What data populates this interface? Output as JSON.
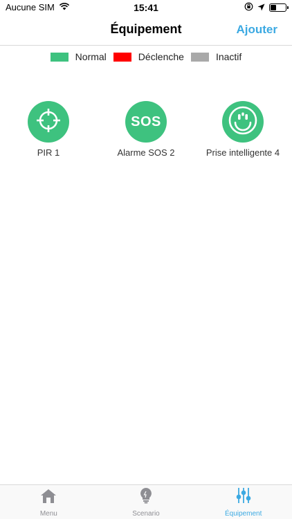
{
  "status_bar": {
    "carrier": "Aucune SIM",
    "time": "15:41",
    "battery_level": 0.4
  },
  "nav": {
    "title": "Équipement",
    "add_label": "Ajouter"
  },
  "legend": [
    {
      "label": "Normal",
      "color": "#3ec27f"
    },
    {
      "label": "Déclenche",
      "color": "#ff0000"
    },
    {
      "label": "Inactif",
      "color": "#a9a9a9"
    }
  ],
  "devices": [
    {
      "name": "PIR 1",
      "icon": "crosshair-icon",
      "status": "Normal",
      "color": "#3ec27f"
    },
    {
      "name": "Alarme SOS 2",
      "icon": "sos-icon",
      "icon_text": "SOS",
      "status": "Normal",
      "color": "#3ec27f"
    },
    {
      "name": "Prise intelligente 4",
      "icon": "power-socket-icon",
      "status": "Normal",
      "color": "#3ec27f"
    }
  ],
  "tabs": [
    {
      "label": "Menu",
      "icon": "home-icon",
      "active": false
    },
    {
      "label": "Scenario",
      "icon": "lightbulb-icon",
      "active": false
    },
    {
      "label": "Équipement",
      "icon": "sliders-icon",
      "active": true
    }
  ],
  "colors": {
    "accent": "#3ba9e2",
    "inactive_tab": "#8e8e93"
  }
}
